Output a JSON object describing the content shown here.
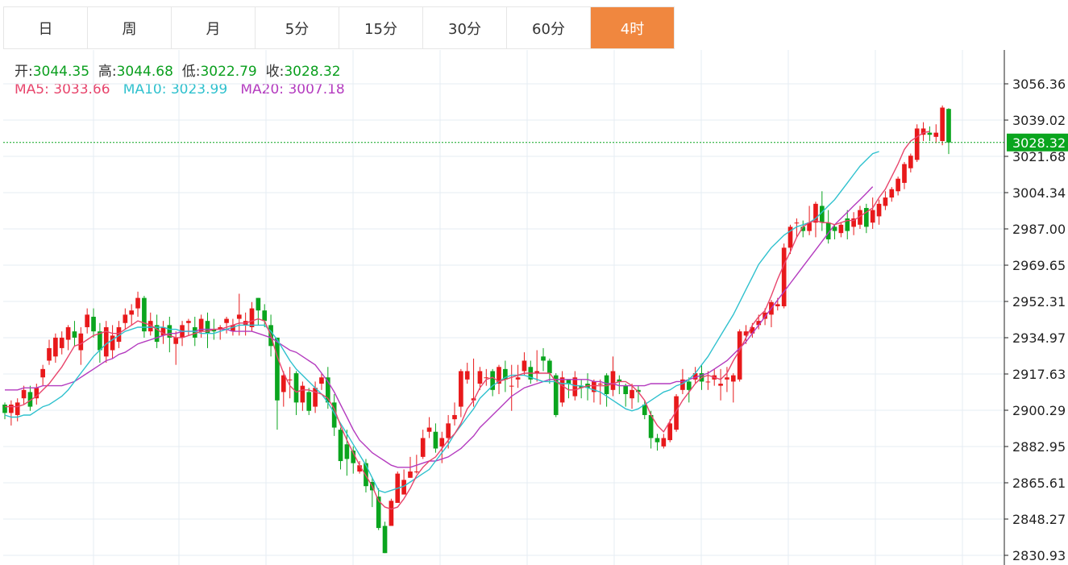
{
  "tabs": [
    {
      "label": "日",
      "active": false
    },
    {
      "label": "周",
      "active": false
    },
    {
      "label": "月",
      "active": false
    },
    {
      "label": "5分",
      "active": false
    },
    {
      "label": "15分",
      "active": false
    },
    {
      "label": "30分",
      "active": false
    },
    {
      "label": "60分",
      "active": false
    },
    {
      "label": "4时",
      "active": true
    }
  ],
  "ohlc_info": {
    "open_label": "开:",
    "open_value": "3044.35",
    "high_label": "高:",
    "high_value": "3044.68",
    "low_label": "低:",
    "low_value": "3022.79",
    "close_label": "收:",
    "close_value": "3028.32"
  },
  "ma_info": {
    "ma5_label": "MA5:",
    "ma5_value": "3033.66",
    "ma10_label": "MA10:",
    "ma10_value": "3023.99",
    "ma20_label": "MA20:",
    "ma20_value": "3007.18"
  },
  "colors": {
    "up": "#e8191b",
    "down": "#0aa51e",
    "ma5": "#e8456c",
    "ma10": "#2fc1ce",
    "ma20": "#b43bbf",
    "accent": "#f0873f",
    "grid": "#e5ecf3",
    "last_price": "#0aa51e"
  },
  "chart_data": {
    "type": "candlestick",
    "y_ticks": [
      "3056.36",
      "3039.02",
      "3021.68",
      "3004.34",
      "2987.00",
      "2969.65",
      "2952.31",
      "2934.97",
      "2917.63",
      "2900.29",
      "2882.95",
      "2865.61",
      "2848.27",
      "2830.93"
    ],
    "ylim": [
      2830.93,
      3056.36
    ],
    "last_price": 3028.32,
    "last_price_label": "3028.32",
    "candles": [
      [
        2903,
        2899,
        2904,
        2896
      ],
      [
        2899,
        2903,
        2905,
        2893
      ],
      [
        2898,
        2904,
        2906,
        2895
      ],
      [
        2906,
        2910,
        2912,
        2903
      ],
      [
        2909,
        2902,
        2912,
        2900
      ],
      [
        2906,
        2911,
        2913,
        2903
      ],
      [
        2916,
        2920,
        2922,
        2912
      ],
      [
        2924,
        2930,
        2934,
        2922
      ],
      [
        2926,
        2935,
        2937,
        2923
      ],
      [
        2930,
        2935,
        2938,
        2927
      ],
      [
        2934,
        2940,
        2941,
        2929
      ],
      [
        2938,
        2935,
        2943,
        2931
      ],
      [
        2929,
        2937,
        2940,
        2922
      ],
      [
        2940,
        2946,
        2949,
        2937
      ],
      [
        2945,
        2938,
        2949,
        2935
      ],
      [
        2938,
        2929,
        2942,
        2923
      ],
      [
        2926,
        2940,
        2943,
        2923
      ],
      [
        2929,
        2936,
        2941,
        2925
      ],
      [
        2933,
        2940,
        2943,
        2930
      ],
      [
        2942,
        2946,
        2949,
        2939
      ],
      [
        2946,
        2948,
        2951,
        2941
      ],
      [
        2949,
        2954,
        2957,
        2945
      ],
      [
        2954,
        2938,
        2955,
        2935
      ],
      [
        2938,
        2943,
        2947,
        2936
      ],
      [
        2941,
        2933,
        2946,
        2930
      ],
      [
        2936,
        2940,
        2943,
        2932
      ],
      [
        2941,
        2935,
        2945,
        2928
      ],
      [
        2932,
        2935,
        2938,
        2922
      ],
      [
        2935,
        2941,
        2943,
        2931
      ],
      [
        2942,
        2943,
        2944,
        2936
      ],
      [
        2940,
        2935,
        2945,
        2931
      ],
      [
        2938,
        2944,
        2946,
        2935
      ],
      [
        2943,
        2937,
        2947,
        2930
      ],
      [
        2939,
        2938,
        2944,
        2934
      ],
      [
        2939,
        2940,
        2941,
        2934
      ],
      [
        2942,
        2944,
        2945,
        2937
      ],
      [
        2938,
        2941,
        2944,
        2936
      ],
      [
        2944,
        2946,
        2956,
        2936
      ],
      [
        2941,
        2943,
        2947,
        2936
      ],
      [
        2940,
        2949,
        2952,
        2938
      ],
      [
        2954,
        2948,
        2954,
        2941
      ],
      [
        2948,
        2943,
        2951,
        2940
      ],
      [
        2941,
        2931,
        2946,
        2926
      ],
      [
        2935,
        2905,
        2935,
        2891
      ],
      [
        2909,
        2917,
        2919,
        2902
      ],
      [
        2915,
        2915,
        2921,
        2906
      ],
      [
        2918,
        2904,
        2919,
        2898
      ],
      [
        2904,
        2912,
        2914,
        2900
      ],
      [
        2909,
        2900,
        2911,
        2898
      ],
      [
        2902,
        2911,
        2914,
        2899
      ],
      [
        2913,
        2916,
        2918,
        2910
      ],
      [
        2916,
        2904,
        2921,
        2901
      ],
      [
        2904,
        2892,
        2908,
        2888
      ],
      [
        2891,
        2876,
        2892,
        2872
      ],
      [
        2884,
        2877,
        2891,
        2869
      ],
      [
        2881,
        2875,
        2883,
        2870
      ],
      [
        2871,
        2874,
        2876,
        2870
      ],
      [
        2875,
        2864,
        2877,
        2861
      ],
      [
        2866,
        2862,
        2868,
        2854
      ],
      [
        2859,
        2844,
        2863,
        2843
      ],
      [
        2845,
        2832,
        2847,
        2832
      ],
      [
        2845,
        2857,
        2858,
        2846
      ],
      [
        2856,
        2870,
        2871,
        2858
      ],
      [
        2860,
        2867,
        2872,
        2861
      ],
      [
        2868,
        2871,
        2878,
        2868
      ],
      [
        2871,
        2871,
        2879,
        2870
      ],
      [
        2878,
        2887,
        2891,
        2877
      ],
      [
        2890,
        2892,
        2897,
        2887
      ],
      [
        2890,
        2882,
        2894,
        2880
      ],
      [
        2883,
        2887,
        2890,
        2875
      ],
      [
        2887,
        2894,
        2898,
        2882
      ],
      [
        2896,
        2898,
        2904,
        2893
      ],
      [
        2902,
        2919,
        2920,
        2897
      ],
      [
        2915,
        2919,
        2923,
        2913
      ],
      [
        2905,
        2906,
        2925,
        2902
      ],
      [
        2913,
        2919,
        2921,
        2910
      ],
      [
        2916,
        2916,
        2920,
        2912
      ],
      [
        2919,
        2910,
        2920,
        2907
      ],
      [
        2913,
        2921,
        2922,
        2908
      ],
      [
        2920,
        2915,
        2924,
        2909
      ],
      [
        2912,
        2912,
        2922,
        2900
      ],
      [
        2915,
        2916,
        2922,
        2911
      ],
      [
        2919,
        2924,
        2928,
        2917
      ],
      [
        2921,
        2915,
        2924,
        2913
      ],
      [
        2918,
        2919,
        2929,
        2914
      ],
      [
        2926,
        2924,
        2930,
        2919
      ],
      [
        2924,
        2918,
        2925,
        2913
      ],
      [
        2917,
        2898,
        2918,
        2897
      ],
      [
        2904,
        2916,
        2919,
        2902
      ],
      [
        2915,
        2913,
        2915,
        2906
      ],
      [
        2907,
        2916,
        2919,
        2905
      ],
      [
        2912,
        2911,
        2915,
        2906
      ],
      [
        2913,
        2911,
        2918,
        2905
      ],
      [
        2909,
        2914,
        2915,
        2904
      ],
      [
        2913,
        2913,
        2915,
        2903
      ],
      [
        2917,
        2908,
        2918,
        2902
      ],
      [
        2910,
        2919,
        2926,
        2907
      ],
      [
        2915,
        2914,
        2917,
        2908
      ],
      [
        2912,
        2908,
        2913,
        2902
      ],
      [
        2906,
        2910,
        2913,
        2901
      ],
      [
        2910,
        2909,
        2912,
        2904
      ],
      [
        2903,
        2898,
        2905,
        2896
      ],
      [
        2898,
        2887,
        2900,
        2882
      ],
      [
        2887,
        2885,
        2889,
        2881
      ],
      [
        2883,
        2887,
        2889,
        2882
      ],
      [
        2886,
        2894,
        2896,
        2885
      ],
      [
        2891,
        2907,
        2908,
        2890
      ],
      [
        2910,
        2915,
        2920,
        2908
      ],
      [
        2914,
        2910,
        2916,
        2904
      ],
      [
        2915,
        2918,
        2921,
        2913
      ],
      [
        2918,
        2914,
        2922,
        2910
      ],
      [
        2914,
        2914,
        2919,
        2910
      ],
      [
        2915,
        2917,
        2920,
        2912
      ],
      [
        2912,
        2913,
        2920,
        2905
      ],
      [
        2915,
        2916,
        2921,
        2909
      ],
      [
        2914,
        2917,
        2918,
        2904
      ],
      [
        2915,
        2938,
        2939,
        2914
      ],
      [
        2936,
        2938,
        2941,
        2932
      ],
      [
        2937,
        2940,
        2942,
        2935
      ],
      [
        2941,
        2943,
        2946,
        2939
      ],
      [
        2944,
        2947,
        2949,
        2941
      ],
      [
        2946,
        2952,
        2953,
        2940
      ],
      [
        2950,
        2951,
        2954,
        2948
      ],
      [
        2950,
        2978,
        2980,
        2949
      ],
      [
        2978,
        2988,
        2989,
        2975
      ],
      [
        2990,
        2990,
        2992,
        2983
      ],
      [
        2988,
        2986,
        2991,
        2983
      ],
      [
        2986,
        2990,
        2998,
        2984
      ],
      [
        2990,
        2999,
        3000,
        2983
      ],
      [
        2998,
        2990,
        3005,
        2986
      ],
      [
        2990,
        2982,
        2996,
        2980
      ],
      [
        2988,
        2986,
        2989,
        2982
      ],
      [
        2985,
        2989,
        2990,
        2983
      ],
      [
        2992,
        2986,
        2996,
        2982
      ],
      [
        2988,
        2992,
        2995,
        2984
      ],
      [
        2989,
        2996,
        2998,
        2987
      ],
      [
        2997,
        2988,
        2999,
        2985
      ],
      [
        2990,
        2996,
        3002,
        2987
      ],
      [
        2993,
        2999,
        3001,
        2989
      ],
      [
        2998,
        3002,
        3005,
        2996
      ],
      [
        3002,
        3006,
        3007,
        3000
      ],
      [
        3005,
        3011,
        3012,
        3003
      ],
      [
        3009,
        3018,
        3019,
        3006
      ],
      [
        3016,
        3022,
        3023,
        3014
      ],
      [
        3020,
        3035,
        3037,
        3019
      ],
      [
        3032,
        3035,
        3038,
        3029
      ],
      [
        3033,
        3032,
        3036,
        3029
      ],
      [
        3031,
        3033,
        3037,
        3028
      ],
      [
        3029,
        3045,
        3046,
        3027
      ],
      [
        3044.35,
        3028.32,
        3044.68,
        3022.79
      ]
    ],
    "ma5": [
      2902,
      2902,
      2902,
      2903,
      2905,
      2907,
      2910,
      2913,
      2917,
      2921,
      2926,
      2931,
      2932,
      2934,
      2936,
      2937,
      2938,
      2937,
      2937,
      2939,
      2941,
      2943,
      2942,
      2941,
      2939,
      2937,
      2936,
      2935,
      2935,
      2936,
      2937,
      2938,
      2938,
      2939,
      2939,
      2940,
      2941,
      2942,
      2942,
      2943,
      2944,
      2943,
      2936,
      2926,
      2918,
      2912,
      2909,
      2910,
      2910,
      2909,
      2908,
      2906,
      2901,
      2893,
      2886,
      2880,
      2874,
      2869,
      2864,
      2857,
      2854,
      2853,
      2854,
      2858,
      2863,
      2869,
      2873,
      2876,
      2878,
      2882,
      2886,
      2889,
      2894,
      2901,
      2905,
      2911,
      2915,
      2916,
      2914,
      2915,
      2916,
      2917,
      2918,
      2918,
      2918,
      2918,
      2918,
      2914,
      2912,
      2910,
      2910,
      2911,
      2912,
      2912,
      2912,
      2912,
      2913,
      2914,
      2914,
      2912,
      2909,
      2905,
      2898,
      2893,
      2890,
      2895,
      2900,
      2905,
      2909,
      2913,
      2916,
      2917,
      2916,
      2915,
      2918,
      2924,
      2929,
      2935,
      2941,
      2945,
      2948,
      2955,
      2963,
      2970,
      2976,
      2983,
      2988,
      2990,
      2991,
      2990,
      2990,
      2989,
      2990,
      2991,
      2991,
      2993,
      2995,
      2997,
      3002,
      3006,
      3012,
      3018,
      3025,
      3029,
      3031,
      3033,
      3033.66
    ],
    "ma10": [
      2898,
      2897,
      2897,
      2898,
      2898,
      2900,
      2902,
      2903,
      2905,
      2907,
      2910,
      2914,
      2918,
      2922,
      2926,
      2929,
      2932,
      2934,
      2936,
      2938,
      2939,
      2940,
      2940,
      2940,
      2940,
      2940,
      2939,
      2939,
      2938,
      2938,
      2938,
      2937,
      2937,
      2937,
      2938,
      2939,
      2940,
      2941,
      2941,
      2941,
      2941,
      2941,
      2938,
      2934,
      2929,
      2924,
      2920,
      2917,
      2914,
      2911,
      2908,
      2904,
      2899,
      2894,
      2889,
      2884,
      2879,
      2874,
      2868,
      2862,
      2861,
      2862,
      2863,
      2864,
      2866,
      2868,
      2870,
      2872,
      2876,
      2880,
      2884,
      2889,
      2893,
      2897,
      2901,
      2906,
      2909,
      2912,
      2914,
      2916,
      2917,
      2917,
      2917,
      2916,
      2915,
      2914,
      2914,
      2914,
      2913,
      2913,
      2912,
      2912,
      2911,
      2910,
      2909,
      2907,
      2905,
      2903,
      2901,
      2900,
      2901,
      2903,
      2905,
      2907,
      2909,
      2910,
      2912,
      2913,
      2915,
      2918,
      2922,
      2926,
      2931,
      2936,
      2941,
      2946,
      2952,
      2958,
      2964,
      2970,
      2974,
      2978,
      2981,
      2984,
      2986,
      2988,
      2989,
      2990,
      2992,
      2995,
      2998,
      3001,
      3005,
      3009,
      3013,
      3017,
      3020,
      3023,
      3023.99
    ],
    "ma20": [
      2910,
      2910,
      2910,
      2911,
      2911,
      2911,
      2912,
      2912,
      2912,
      2912,
      2913,
      2914,
      2916,
      2918,
      2920,
      2922,
      2924,
      2925,
      2927,
      2928,
      2930,
      2932,
      2933,
      2934,
      2935,
      2936,
      2937,
      2937,
      2938,
      2938,
      2938,
      2939,
      2939,
      2939,
      2939,
      2939,
      2938,
      2938,
      2938,
      2938,
      2937,
      2936,
      2935,
      2933,
      2931,
      2929,
      2928,
      2926,
      2924,
      2922,
      2918,
      2914,
      2909,
      2903,
      2897,
      2891,
      2886,
      2883,
      2880,
      2878,
      2876,
      2874,
      2873,
      2873,
      2873,
      2874,
      2875,
      2876,
      2876,
      2877,
      2878,
      2880,
      2882,
      2885,
      2888,
      2892,
      2895,
      2898,
      2901,
      2904,
      2907,
      2909,
      2911,
      2912,
      2913,
      2914,
      2915,
      2915,
      2915,
      2915,
      2915,
      2915,
      2915,
      2914,
      2914,
      2913,
      2913,
      2912,
      2912,
      2912,
      2912,
      2912,
      2913,
      2913,
      2913,
      2913,
      2914,
      2914,
      2915,
      2916,
      2917,
      2918,
      2920,
      2922,
      2924,
      2927,
      2930,
      2933,
      2937,
      2941,
      2945,
      2949,
      2953,
      2957,
      2961,
      2965,
      2969,
      2973,
      2977,
      2981,
      2985,
      2989,
      2992,
      2995,
      2998,
      3001,
      3004,
      3007.18
    ]
  }
}
